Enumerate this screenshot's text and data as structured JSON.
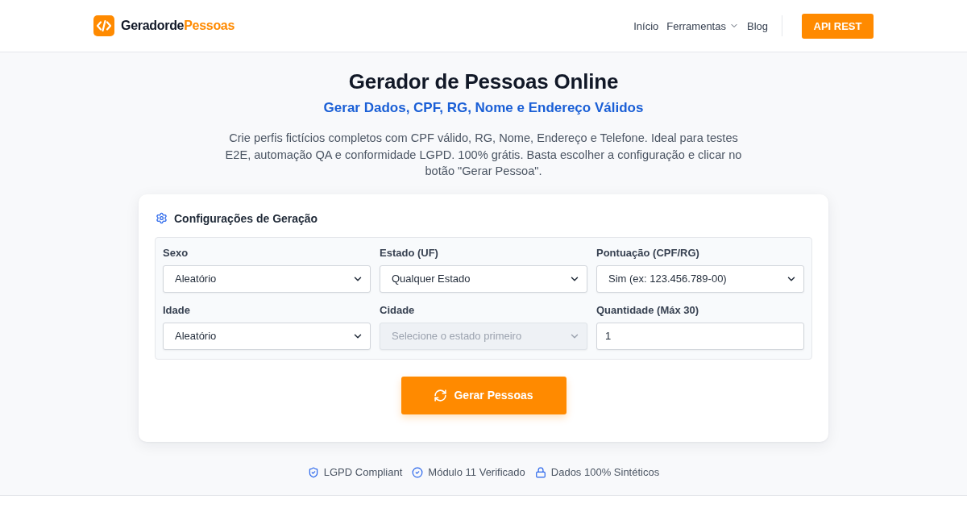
{
  "header": {
    "logo": {
      "text_start": "Geradorde",
      "text_accent": "Pessoas"
    },
    "nav": [
      {
        "label": "Início",
        "kind": "link"
      },
      {
        "label": "Ferramentas",
        "kind": "dropdown"
      },
      {
        "label": "Blog",
        "kind": "link"
      }
    ],
    "cta": "API REST"
  },
  "hero": {
    "title": "Gerador de Pessoas Online",
    "subtitle": "Gerar Dados, CPF, RG, Nome e Endereço Válidos",
    "description": "Crie perfis fictícios completos com CPF válido, RG, Nome, Endereço e Telefone. Ideal para testes E2E, automação QA e conformidade LGPD. 100% grátis. Basta escolher a configuração e clicar no botão \"Gerar Pessoa\"."
  },
  "config": {
    "title": "Configurações de Geração",
    "fields": [
      {
        "label": "Sexo",
        "kind": "select",
        "value": "Aleatório",
        "disabled": false
      },
      {
        "label": "Estado (UF)",
        "kind": "select",
        "value": "Qualquer Estado",
        "disabled": false
      },
      {
        "label": "Pontuação (CPF/RG)",
        "kind": "select",
        "value": "Sim (ex: 123.456.789-00)",
        "disabled": false
      },
      {
        "label": "Idade",
        "kind": "select",
        "value": "Aleatório",
        "disabled": false
      },
      {
        "label": "Cidade",
        "kind": "select",
        "value": "Selecione o estado primeiro",
        "disabled": true
      },
      {
        "label": "Quantidade (Máx 30)",
        "kind": "number",
        "value": "1",
        "disabled": false
      }
    ],
    "button": "Gerar Pessoas"
  },
  "badges": [
    {
      "label": "LGPD Compliant",
      "kind": "shield"
    },
    {
      "label": "Módulo 11 Verificado",
      "kind": "check"
    },
    {
      "label": "Dados 100% Sintéticos",
      "kind": "lock"
    }
  ]
}
